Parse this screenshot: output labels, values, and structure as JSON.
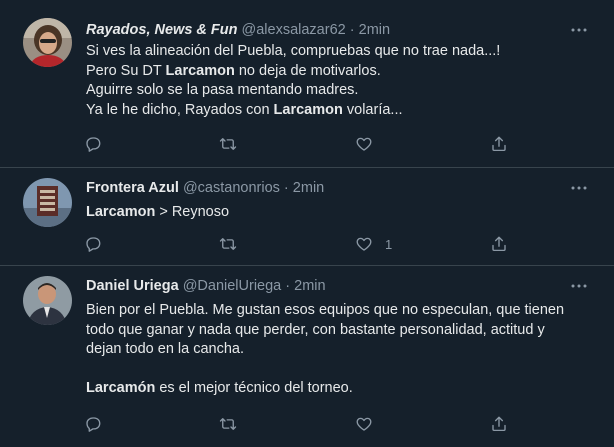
{
  "tweets": [
    {
      "name": "Rayados, News & Fun",
      "handle": "@alexsalazar62",
      "separator": "·",
      "time": "2min",
      "lines": [
        {
          "a": "Si ves la alineación del Puebla, compruebas que no trae nada...!",
          "b": "",
          "c": ""
        },
        {
          "a": "Pero Su DT ",
          "b": "Larcamon",
          "c": " no deja de motivarlos."
        },
        {
          "a": "Aguirre solo se la pasa mentando madres.",
          "b": "",
          "c": ""
        },
        {
          "a": "Ya le he dicho, Rayados con ",
          "b": "Larcamon",
          "c": " volaría..."
        }
      ],
      "like_count": ""
    },
    {
      "name": "Frontera Azul",
      "handle": "@castanonrios",
      "separator": "·",
      "time": "2min",
      "lines": [
        {
          "a": "",
          "b": "Larcamon",
          "c": " > Reynoso"
        }
      ],
      "like_count": "1"
    },
    {
      "name": "Daniel Uriega",
      "handle": "@DanielUriega",
      "separator": "·",
      "time": "2min",
      "lines": [
        {
          "a": "Bien por el Puebla. Me gustan esos equipos que no especulan, que tienen",
          "b": "",
          "c": ""
        },
        {
          "a": "todo que ganar y nada que perder, con bastante personalidad, actitud y",
          "b": "",
          "c": ""
        },
        {
          "a": "dejan todo en la cancha.",
          "b": "",
          "c": ""
        },
        {
          "a": "",
          "b": "Larcamón",
          "c": " es el mejor técnico del torneo."
        }
      ],
      "like_count": ""
    }
  ],
  "icons": {
    "reply": "reply-icon",
    "retweet": "retweet-icon",
    "like": "heart-icon",
    "share": "share-icon",
    "more": "more-options-icon"
  },
  "colors": {
    "background": "#15202b",
    "divider": "#38444d",
    "text_primary": "#e7e9ea",
    "text_secondary": "#8b98a5"
  }
}
